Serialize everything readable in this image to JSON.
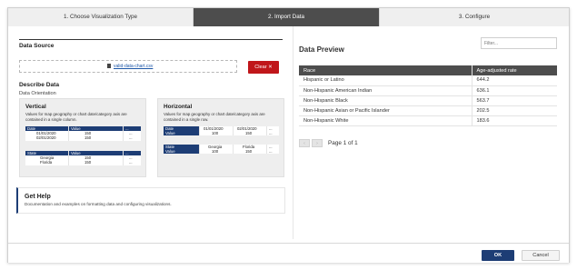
{
  "steps": [
    {
      "label": "1. Choose Visualization Type"
    },
    {
      "label": "2. Import Data"
    },
    {
      "label": "3. Configure"
    }
  ],
  "data_source": {
    "title": "Data Source",
    "file_name": "valid-data-chart.csv",
    "clear_label": "Clear ✕"
  },
  "describe": {
    "title": "Describe Data",
    "orientation_label": "Data Orientation",
    "vertical": {
      "title": "Vertical",
      "desc": "Values for map geography or chart date/category axis are contained in a single column.",
      "t1": {
        "headers": [
          "Date",
          "Value",
          "..."
        ],
        "rows": [
          [
            "01/01/2020",
            "150",
            "..."
          ],
          [
            "02/01/2020",
            "150",
            "..."
          ]
        ]
      },
      "t2": {
        "headers": [
          "State",
          "Value",
          "..."
        ],
        "rows": [
          [
            "Georgia",
            "150",
            "..."
          ],
          [
            "Florida",
            "150",
            "..."
          ]
        ]
      }
    },
    "horizontal": {
      "title": "Horizontal",
      "desc": "Values for map geography or chart date/category axis are contained in a single row.",
      "t1": {
        "label1": "Date",
        "row1": [
          "01/01/2020",
          "02/01/2020",
          "..."
        ],
        "label2": "Value",
        "row2": [
          "100",
          "150",
          "..."
        ]
      },
      "t2": {
        "label1": "State",
        "row1": [
          "Georgia",
          "Florida",
          "..."
        ],
        "label2": "Value",
        "row2": [
          "100",
          "150",
          "..."
        ]
      }
    }
  },
  "help": {
    "title": "Get Help",
    "text": "Documentation and examples on formatting data and configuring visualizations."
  },
  "preview": {
    "title": "Data Preview",
    "filter_placeholder": "Filter...",
    "columns": [
      "Race",
      "Age-adjusted rate"
    ],
    "rows": [
      [
        "Hispanic or Latino",
        "644.2"
      ],
      [
        "Non-Hispanic American Indian",
        "636.1"
      ],
      [
        "Non-Hispanic Black",
        "563.7"
      ],
      [
        "Non-Hispanic Asian or Pacific Islander",
        "202.5"
      ],
      [
        "Non-Hispanic White",
        "183.6"
      ]
    ],
    "page_info": "Page 1 of 1",
    "prev_icon": "chevron-left-icon",
    "next_icon": "chevron-right-icon"
  },
  "footer": {
    "ok_label": "OK",
    "cancel_label": "Cancel"
  }
}
